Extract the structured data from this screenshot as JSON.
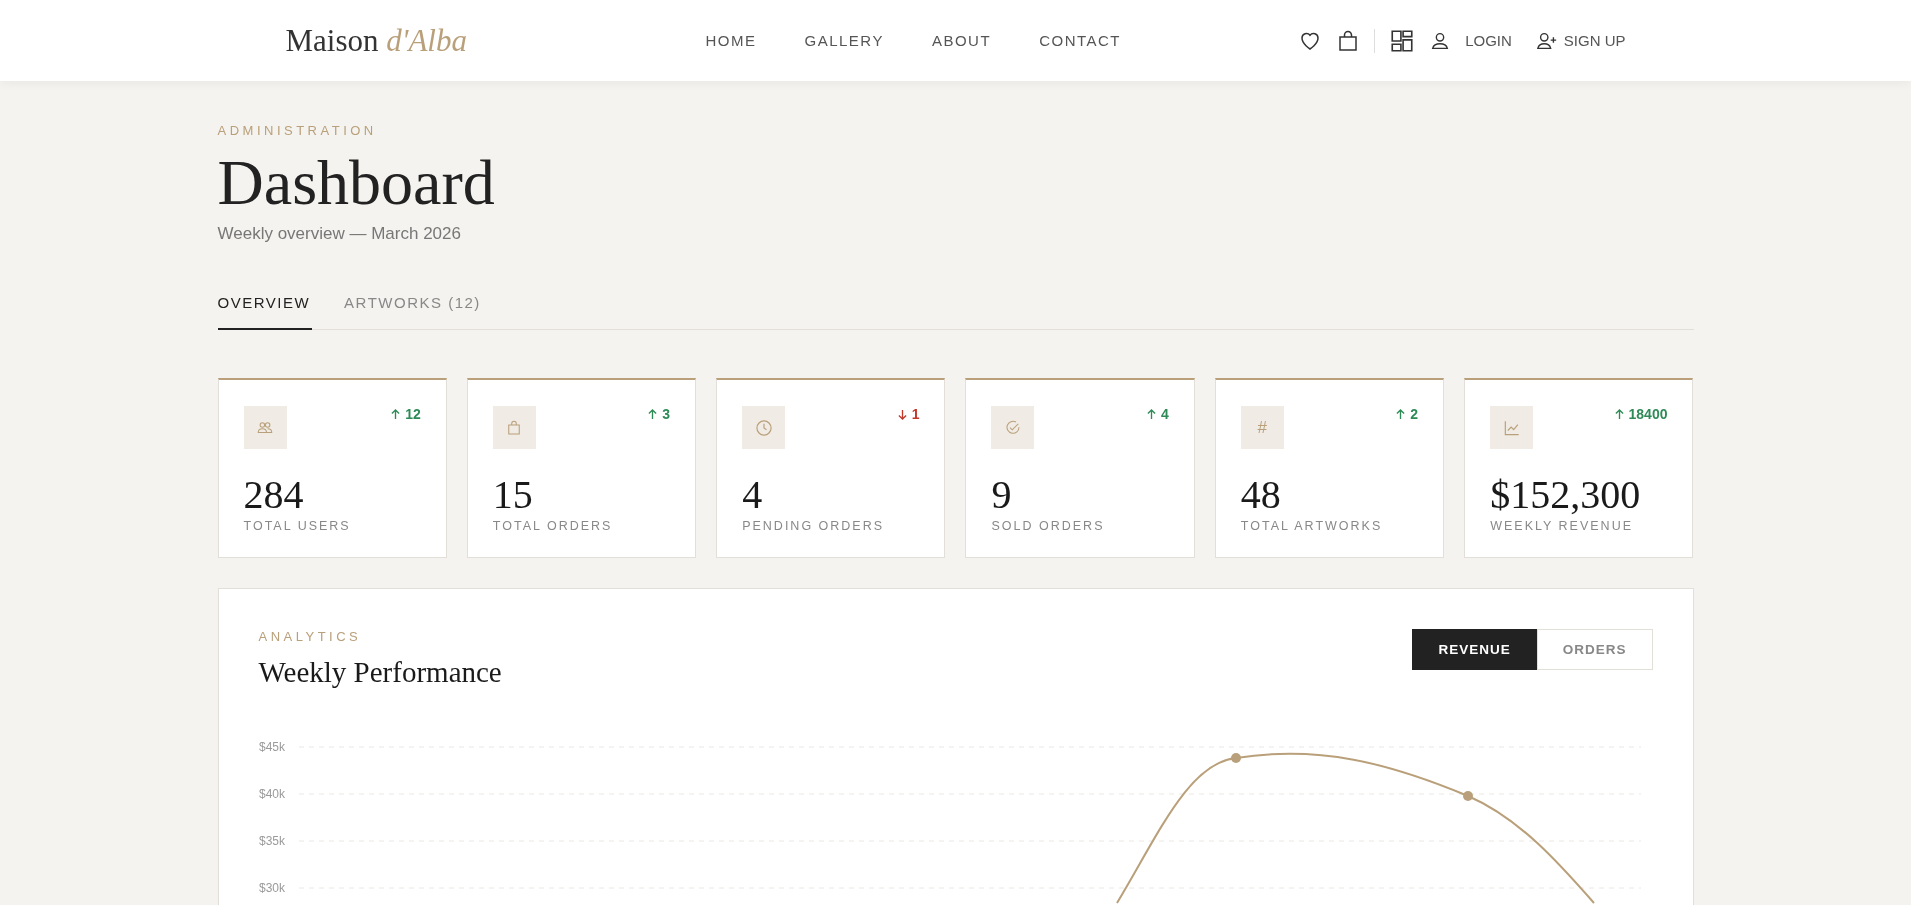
{
  "header": {
    "logo": {
      "main": "Maison",
      "accent": "d'Alba"
    },
    "nav": [
      {
        "label": "HOME"
      },
      {
        "label": "GALLERY"
      },
      {
        "label": "ABOUT"
      },
      {
        "label": "CONTACT"
      }
    ],
    "actions": [
      {
        "kind": "heart"
      },
      {
        "kind": "bag"
      },
      {
        "kind": "divider"
      },
      {
        "kind": "grid"
      },
      {
        "kind": "user"
      },
      {
        "kind": "link",
        "label": "LOGIN"
      },
      {
        "kind": "user-plus",
        "label": "SIGN UP"
      }
    ]
  },
  "page": {
    "eyebrow": "ADMINISTRATION",
    "title": "Dashboard",
    "subtitle": "Weekly overview — March 2026"
  },
  "tabs": [
    {
      "label": "OVERVIEW",
      "selected": true
    },
    {
      "label": "ARTWORKS (12)",
      "selected": false
    }
  ],
  "stats": [
    {
      "kind": "users",
      "value": "284",
      "label": "TOTAL USERS",
      "trend": {
        "kind": "up",
        "value": "12"
      }
    },
    {
      "kind": "bag",
      "value": "15",
      "label": "TOTAL ORDERS",
      "trend": {
        "kind": "up",
        "value": "3"
      }
    },
    {
      "kind": "clock",
      "value": "4",
      "label": "PENDING ORDERS",
      "trend": {
        "kind": "down",
        "value": "1"
      }
    },
    {
      "kind": "check",
      "value": "9",
      "label": "SOLD ORDERS",
      "trend": {
        "kind": "up",
        "value": "4"
      }
    },
    {
      "kind": "hash",
      "icon_text": "#",
      "value": "48",
      "label": "TOTAL ARTWORKS",
      "trend": {
        "kind": "up",
        "value": "2"
      }
    },
    {
      "kind": "chart",
      "value": "$152,300",
      "label": "WEEKLY REVENUE",
      "trend": {
        "kind": "up",
        "value": "18400"
      }
    }
  ],
  "analytics": {
    "eyebrow": "ANALYTICS",
    "title": "Weekly Performance",
    "toggles": [
      {
        "label": "REVENUE",
        "selected": true
      },
      {
        "label": "ORDERS",
        "selected": false
      }
    ],
    "axis_labels": [
      "$45k",
      "$40k",
      "$35k",
      "$30k"
    ]
  }
}
